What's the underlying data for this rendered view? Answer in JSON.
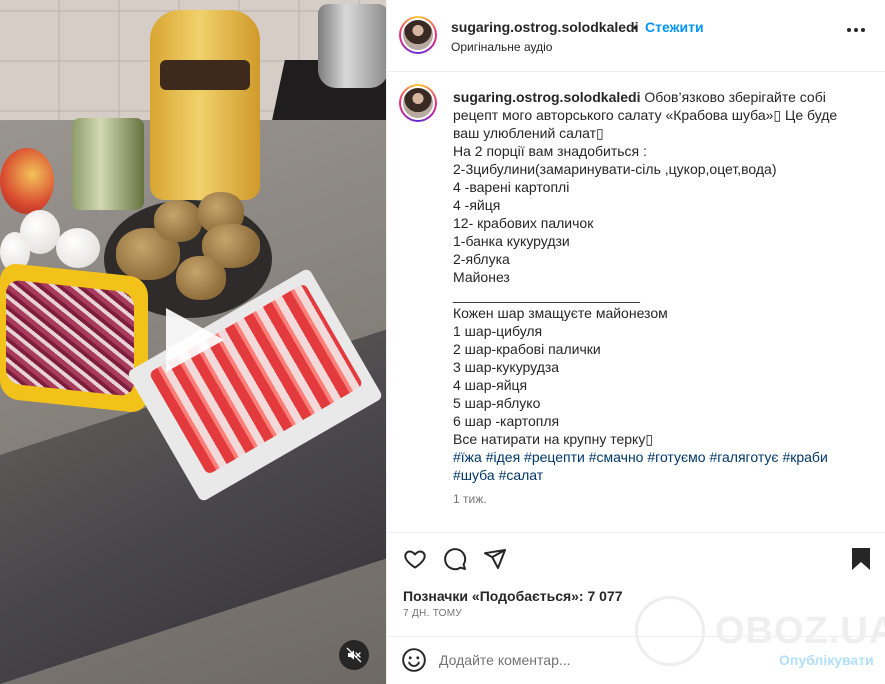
{
  "post": {
    "username": "sugaring.ostrog.solodkaledi",
    "dot": "•",
    "follow_label": "Стежити",
    "audio": "Оригінальне аудіо",
    "caption_lines": [
      "Обов’язково зберігайте собі",
      "рецепт мого авторського салату «Крабова шуба»▯ Це буде",
      "ваш улюблений салат▯",
      "На 2 порції вам знадобиться :",
      "2-3цибулини(замаринувати-сіль ,цукор,оцет,вода)",
      "4 -варені картоплі",
      "4 -яйця",
      "12- крабових паличок",
      "1-банка кукурудзи",
      "2-яблука",
      "Майонез",
      "________________________",
      "Кожен шар змащуєте майонезом",
      "1 шар-цибуля",
      "2 шар-крабові палички",
      "3 шар-кукурудза",
      "4 шар-яйця",
      "5 шар-яблуко",
      "6 шар -картопля",
      "Все натирати на крупну терку▯"
    ],
    "hashtags_line1": [
      "#їжа",
      "#ідея",
      "#рецепти",
      "#смачно",
      "#готуємо",
      "#галяготує",
      "#краби"
    ],
    "hashtags_line2": [
      "#шуба",
      "#салат"
    ],
    "caption_time": "1 тиж.",
    "likes_text": "Позначки «Подобається»: 7 077",
    "date_text": "7 ДН. ТОМУ"
  },
  "comment": {
    "placeholder": "Додайте коментар...",
    "post_label": "Опублікувати"
  },
  "watermark": {
    "text": "OBOZ.UA"
  },
  "icons": {
    "like": "heart-icon",
    "comment": "comment-bubble-icon",
    "share": "paper-plane-icon",
    "save": "bookmark-icon",
    "more": "more-options-icon",
    "emoji": "emoji-icon",
    "mute": "mute-icon",
    "play": "play-icon"
  },
  "colors": {
    "follow": "#0095f6",
    "hashtag": "#00376b",
    "post_disabled": "#b2dffc"
  }
}
